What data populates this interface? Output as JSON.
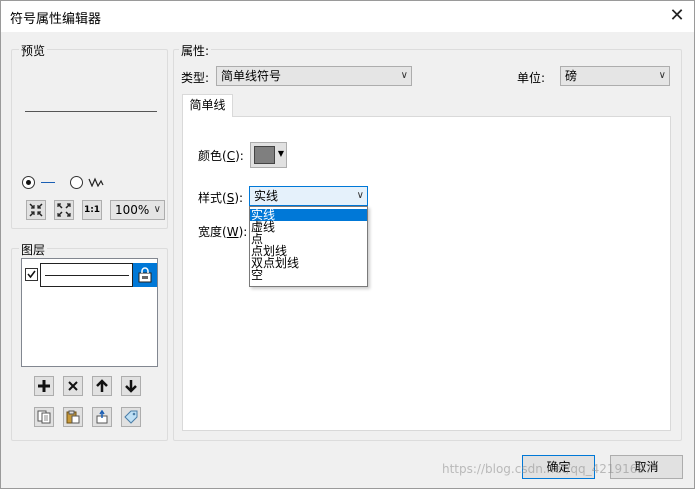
{
  "window": {
    "title": "符号属性编辑器",
    "close_glyph": "✕"
  },
  "preview": {
    "label": "预览",
    "zoom": "100%",
    "zoom_icons": [
      "zoom-in-icon",
      "zoom-extent-icon",
      "actual-size-icon"
    ],
    "zoom_11_glyph": "1:1"
  },
  "layers": {
    "label": "图层",
    "buttons": [
      "add-icon",
      "delete-icon",
      "move-up-icon",
      "move-down-icon"
    ],
    "buttons2": [
      "copy-icon",
      "paste-icon",
      "reset-icon",
      "tag-icon"
    ]
  },
  "properties": {
    "label": "属性:",
    "type_label": "类型:",
    "type_value": "简单线符号",
    "unit_label": "单位:",
    "unit_value": "磅",
    "tab_label": "简单线",
    "color_label_pre": "颜色(",
    "color_key": "C",
    "color_label_post": "):",
    "color_value": "#7f7f7f",
    "style_label_pre": "样式(",
    "style_key": "S",
    "style_label_post": "):",
    "style_value": "实线",
    "width_label_pre": "宽度(",
    "width_key": "W",
    "width_label_post": "):",
    "style_options": [
      "实线",
      "虚线",
      "点",
      "点划线",
      "双点划线",
      "空"
    ]
  },
  "footer": {
    "ok_label": "确定",
    "cancel_label": "取消",
    "watermark": "https://blog.csdn.net/qq_42191697"
  },
  "colors": {
    "accent": "#0078d7",
    "selection": "#0078d7"
  }
}
